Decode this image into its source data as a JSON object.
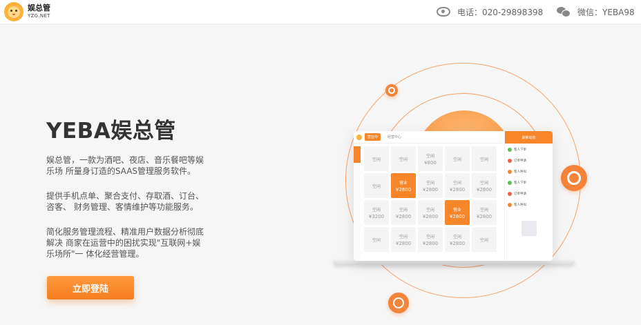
{
  "header": {
    "brand_name": "娱总管",
    "brand_domain": "YZG.NET",
    "phone_label": "电话：020-29898398",
    "wechat_label": "微信：YEBA98",
    "icons": {
      "phone": "eye-icon",
      "wechat": "wechat-icon"
    }
  },
  "hero": {
    "title": "YEBA娱总管",
    "para1": "娱总管，一款为酒吧、夜店、音乐餐吧等娱乐场 所量身订造的SAAS管理服务软件。",
    "para2": "提供手机点单、聚合支付、存取酒、订台、咨客、 财务管理、客情维护等功能服务。",
    "para3": "简化服务管理流程、精准用户数据分析彻底解决 商家在运营中的困扰实现\"互联网+娱乐场所\"一 体化经营管理。",
    "login_button": "立即登陆"
  },
  "mock_app": {
    "tabs": [
      "营业中",
      "经营中心"
    ],
    "panel_title": "最新动态",
    "cells": [
      {
        "label": "空闲",
        "price": ""
      },
      {
        "label": "空闲",
        "price": ""
      },
      {
        "label": "空闲",
        "price": "¥800"
      },
      {
        "label": "空闲",
        "price": ""
      },
      {
        "label": "空闲",
        "price": ""
      },
      {
        "label": "空闲",
        "price": ""
      },
      {
        "label": "营业",
        "price": "¥2800",
        "hot": true
      },
      {
        "label": "空闲",
        "price": "¥2800"
      },
      {
        "label": "空闲",
        "price": "¥2800"
      },
      {
        "label": "空闲",
        "price": "¥2800"
      },
      {
        "label": "空闲",
        "price": "¥3200"
      },
      {
        "label": "空闲",
        "price": "¥2800"
      },
      {
        "label": "空闲",
        "price": "¥2800"
      },
      {
        "label": "营业",
        "price": "¥2800",
        "hot": true
      },
      {
        "label": "空闲",
        "price": "¥2800"
      },
      {
        "label": "空闲",
        "price": ""
      },
      {
        "label": "空闲",
        "price": "¥2800"
      },
      {
        "label": "空闲",
        "price": "¥2800"
      },
      {
        "label": "空闲",
        "price": "¥2800"
      },
      {
        "label": "空闲",
        "price": ""
      }
    ],
    "panel_items": [
      {
        "text": "客人下单",
        "color": "#5bbf5b"
      },
      {
        "text": "订单申请",
        "color": "#f0604a"
      },
      {
        "text": "客人呼叫",
        "color": "#f7862a"
      },
      {
        "text": "客人下单",
        "color": "#5bbf5b"
      },
      {
        "text": "订单申请",
        "color": "#f0604a"
      },
      {
        "text": "客人呼叫",
        "color": "#f7862a"
      }
    ]
  },
  "colors": {
    "accent": "#f7862a",
    "brand": "#ffb13a"
  }
}
